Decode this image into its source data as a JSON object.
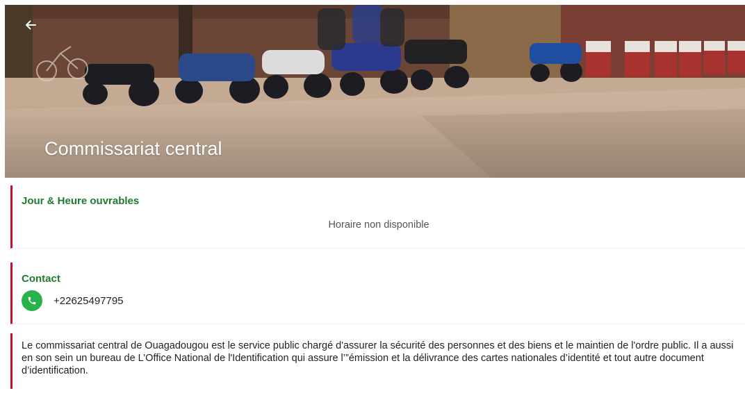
{
  "header": {
    "title": "Commissariat central",
    "back_icon": "arrow-left-icon"
  },
  "hours": {
    "title": "Jour & Heure ouvrables",
    "value": "Horaire non disponible"
  },
  "contact": {
    "title": "Contact",
    "phone": "+22625497795",
    "phone_icon": "phone-icon"
  },
  "description": {
    "text": "Le commissariat central de Ouagadougou est le service public chargé d'assurer la sécurité des personnes et des biens et le maintien de l'ordre public. Il a aussi en son sein un bureau de L’Office National de l'Identification qui assure l’”émission et la délivrance des cartes nationales d’identité et tout autre document d’identification."
  },
  "colors": {
    "accent_bar": "#c8102e",
    "section_title": "#1e7a32",
    "phone_button": "#28b34a"
  }
}
